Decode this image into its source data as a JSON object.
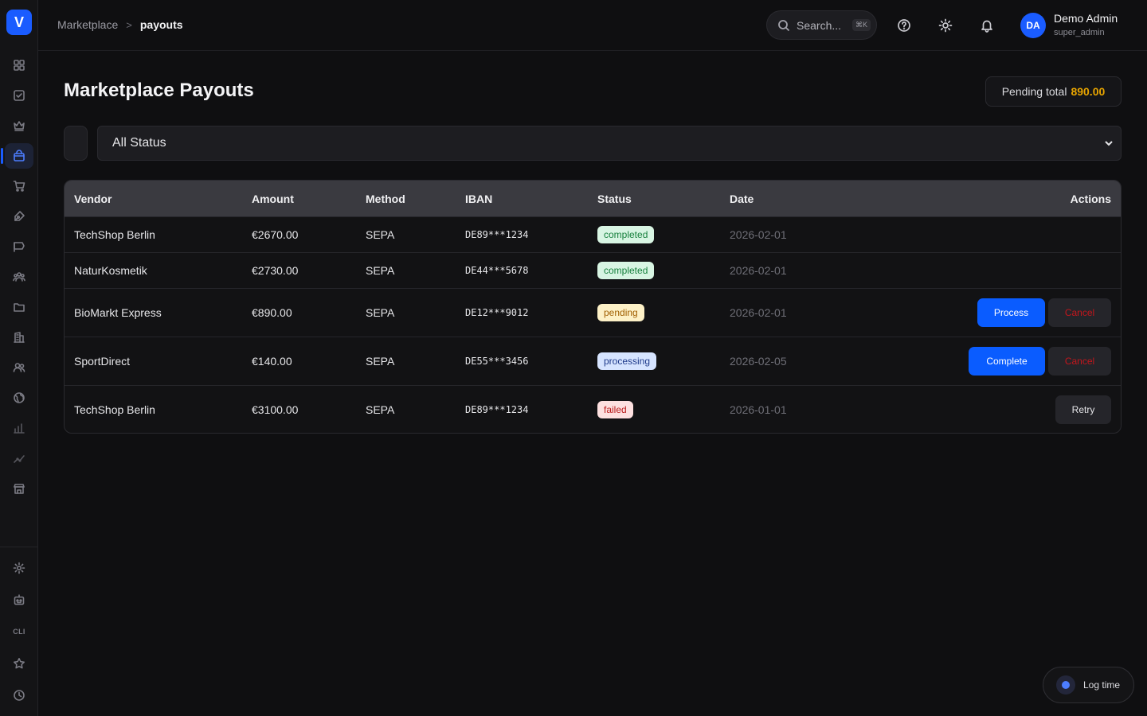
{
  "app": {
    "logo_letter": "V"
  },
  "sidebar": {
    "items": [
      {
        "icon": "dashboard-icon"
      },
      {
        "icon": "checklist-icon"
      },
      {
        "icon": "crown-icon"
      },
      {
        "icon": "shopping-bag-icon",
        "active": true
      },
      {
        "icon": "cart-icon"
      },
      {
        "icon": "pen-tool-icon"
      },
      {
        "icon": "flag-icon"
      },
      {
        "icon": "team-icon"
      },
      {
        "icon": "folder-icon"
      },
      {
        "icon": "building-icon"
      },
      {
        "icon": "users-icon"
      },
      {
        "icon": "globe-icon"
      },
      {
        "icon": "bar-chart-icon"
      },
      {
        "icon": "trend-icon"
      },
      {
        "icon": "store-icon"
      }
    ],
    "bottom": [
      {
        "icon": "gear-icon"
      },
      {
        "icon": "robot-icon"
      },
      {
        "label": "CLI"
      },
      {
        "icon": "star-icon"
      },
      {
        "icon": "clock-icon"
      }
    ]
  },
  "breadcrumb": {
    "parent": "Marketplace",
    "separator": ">",
    "current": "payouts"
  },
  "topbar": {
    "search_placeholder": "Search...",
    "search_shortcut": "⌘K",
    "user": {
      "initials": "DA",
      "name": "Demo Admin",
      "role": "super_admin"
    }
  },
  "page": {
    "title": "Marketplace Payouts",
    "pending_label": "Pending total",
    "pending_value": "890.00"
  },
  "filters": {
    "status_selected": "All Status"
  },
  "table": {
    "headers": {
      "vendor": "Vendor",
      "amount": "Amount",
      "method": "Method",
      "iban": "IBAN",
      "status": "Status",
      "date": "Date",
      "actions": "Actions"
    },
    "rows": [
      {
        "vendor": "TechShop Berlin",
        "amount": "€2670.00",
        "method": "SEPA",
        "iban": "DE89***1234",
        "status": "completed",
        "date": "2026-02-01",
        "actions": []
      },
      {
        "vendor": "NaturKosmetik",
        "amount": "€2730.00",
        "method": "SEPA",
        "iban": "DE44***5678",
        "status": "completed",
        "date": "2026-02-01",
        "actions": []
      },
      {
        "vendor": "BioMarkt Express",
        "amount": "€890.00",
        "method": "SEPA",
        "iban": "DE12***9012",
        "status": "pending",
        "date": "2026-02-01",
        "actions": [
          "Process",
          "Cancel"
        ]
      },
      {
        "vendor": "SportDirect",
        "amount": "€140.00",
        "method": "SEPA",
        "iban": "DE55***3456",
        "status": "processing",
        "date": "2026-02-05",
        "actions": [
          "Complete",
          "Cancel"
        ]
      },
      {
        "vendor": "TechShop Berlin",
        "amount": "€3100.00",
        "method": "SEPA",
        "iban": "DE89***1234",
        "status": "failed",
        "date": "2026-01-01",
        "actions": [
          "Retry"
        ]
      }
    ]
  },
  "log_time": {
    "label": "Log time"
  },
  "colors": {
    "accent": "#0a5cff",
    "pending": "#e8a500",
    "cancel": "#c4161c"
  }
}
